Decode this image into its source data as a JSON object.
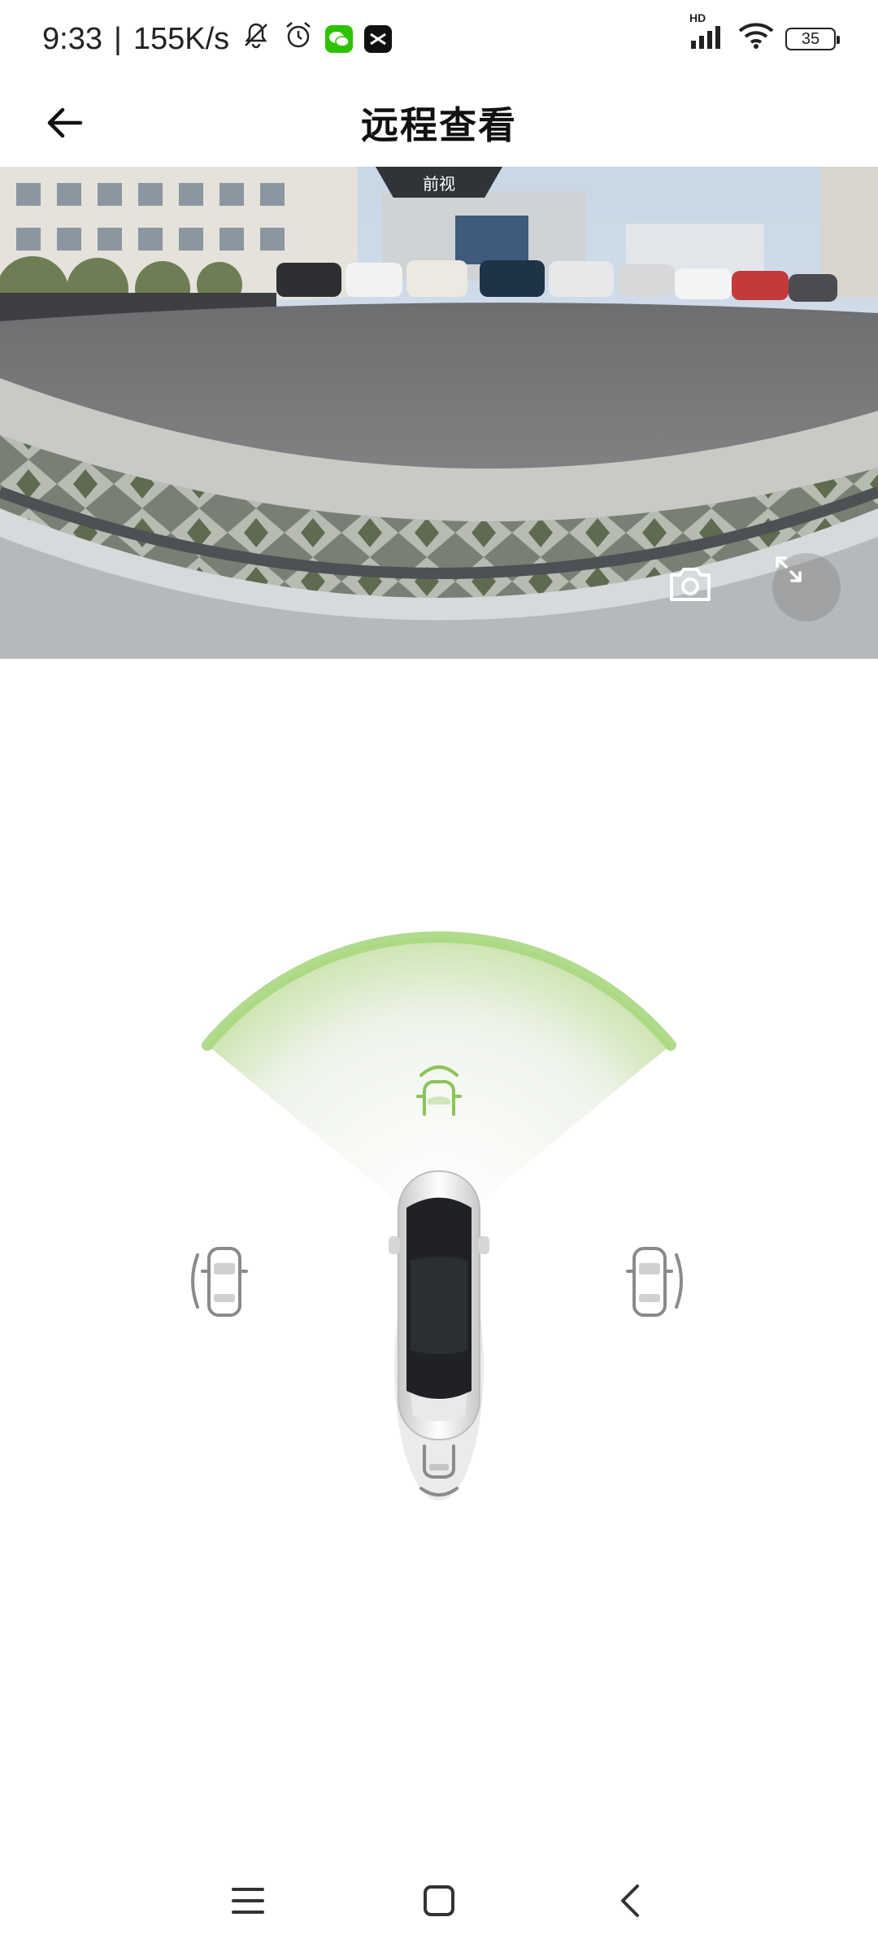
{
  "status_bar": {
    "time": "9:33",
    "separator": "|",
    "network_speed": "155K/s",
    "icons": [
      "mute-icon",
      "alarm-icon",
      "wechat-icon",
      "capcut-icon",
      "signal-icon",
      "wifi-icon"
    ],
    "signal_label": "HD",
    "battery_level": "35"
  },
  "header": {
    "title": "远程查看",
    "back_icon": "arrow-left-icon"
  },
  "camera": {
    "view_label": "前视",
    "active_view": "front",
    "snapshot_icon": "camera-icon",
    "fullscreen_icon": "expand-icon"
  },
  "camera_selector": {
    "options": [
      "front",
      "left",
      "right",
      "rear"
    ],
    "selected": "front",
    "accent_color": "#8cc35a",
    "inactive_color": "#8a8a8a"
  },
  "nav_bar": {
    "icons": [
      "menu-icon",
      "home-icon",
      "back-icon"
    ]
  }
}
